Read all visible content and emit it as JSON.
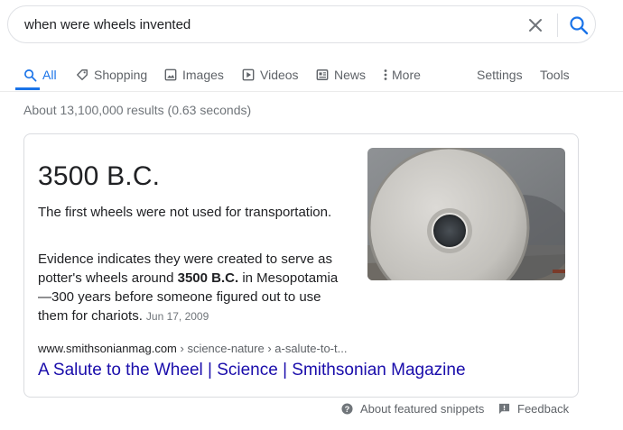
{
  "search": {
    "query": "when were wheels invented",
    "clear_icon": "close-icon",
    "search_icon": "search-icon"
  },
  "tabs": [
    {
      "label": "All",
      "icon": "search-icon",
      "active": true
    },
    {
      "label": "Shopping",
      "icon": "tag-icon"
    },
    {
      "label": "Images",
      "icon": "image-icon"
    },
    {
      "label": "Videos",
      "icon": "play-icon"
    },
    {
      "label": "News",
      "icon": "news-icon"
    },
    {
      "label": "More",
      "icon": "more-vertical-icon"
    }
  ],
  "tools": {
    "settings_label": "Settings",
    "tools_label": "Tools"
  },
  "result_stats": "About 13,100,000 results (0.63 seconds)",
  "featured_snippet": {
    "answer": "3500 B.C.",
    "lead": "The first wheels were not used for transportation.",
    "snippet_before": "Evidence indicates they were created to serve as potter's wheels around ",
    "snippet_bold": "3500 B.C.",
    "snippet_after": " in Mesopotamia—300 years before someone figured out to use them for chariots.",
    "date": "Jun 17, 2009",
    "site": "www.smithsonianmag.com",
    "path": " › science-nature › a-salute-to-t...",
    "title": "A Salute to the Wheel | Science | Smithsonian Magazine"
  },
  "footer": {
    "about_label": "About featured snippets",
    "feedback_label": "Feedback"
  },
  "colors": {
    "accent": "#1a73e8",
    "link": "#1a0dab",
    "muted": "#70757a"
  }
}
